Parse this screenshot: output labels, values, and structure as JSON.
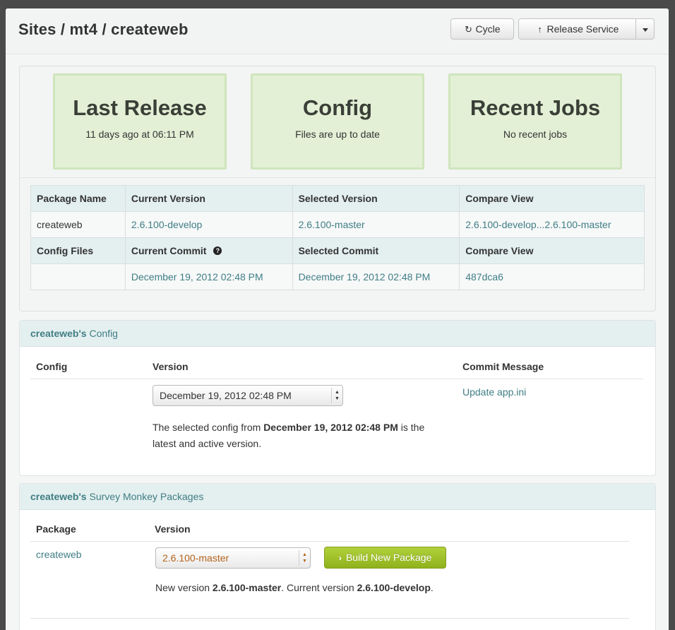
{
  "header": {
    "title": "Sites / mt4 / createweb",
    "cycle_label": "Cycle",
    "release_label": "Release Service",
    "cycle_icon": "refresh-icon",
    "release_icon": "arrow-up-icon"
  },
  "tiles": [
    {
      "title": "Last Release",
      "subtitle": "11 days ago at 06:11 PM"
    },
    {
      "title": "Config",
      "subtitle": "Files are up to date"
    },
    {
      "title": "Recent Jobs",
      "subtitle": "No recent jobs"
    }
  ],
  "info_table": {
    "headers1": [
      "Package Name",
      "Current Version",
      "Selected Version",
      "Compare View"
    ],
    "row1": [
      "createweb",
      "2.6.100-develop",
      "2.6.100-master",
      "2.6.100-develop...2.6.100-master"
    ],
    "headers2": [
      "Config Files",
      "Current Commit",
      "Selected Commit",
      "Compare View"
    ],
    "row2": [
      "",
      "December 19, 2012 02:48 PM",
      "December 19, 2012 02:48 PM",
      "487dca6"
    ]
  },
  "config_panel": {
    "owner": "createweb's",
    "title": "Config",
    "col_config": "Config",
    "col_version": "Version",
    "col_commit": "Commit Message",
    "selected_version": "December 19, 2012 02:48 PM",
    "commit_message": "Update app.ini",
    "help_prefix": "The selected config from ",
    "help_date": "December 19, 2012 02:48 PM",
    "help_suffix_line1": " is the",
    "help_line2": "latest and active version."
  },
  "packages_panel": {
    "owner": "createweb's",
    "title": "Survey Monkey Packages",
    "col_package": "Package",
    "col_version": "Version",
    "package_name": "createweb",
    "selected_version": "2.6.100-master",
    "build_label": "Build New Package",
    "note_prefix": "New version ",
    "note_new": "2.6.100-master",
    "note_mid": ". Current version ",
    "note_current": "2.6.100-develop",
    "note_end": "."
  },
  "colors": {
    "link": "#3f7e85",
    "tile_bg": "#e3f0d6",
    "build_button": "#9fc12a",
    "warning_text": "#b5651d"
  }
}
